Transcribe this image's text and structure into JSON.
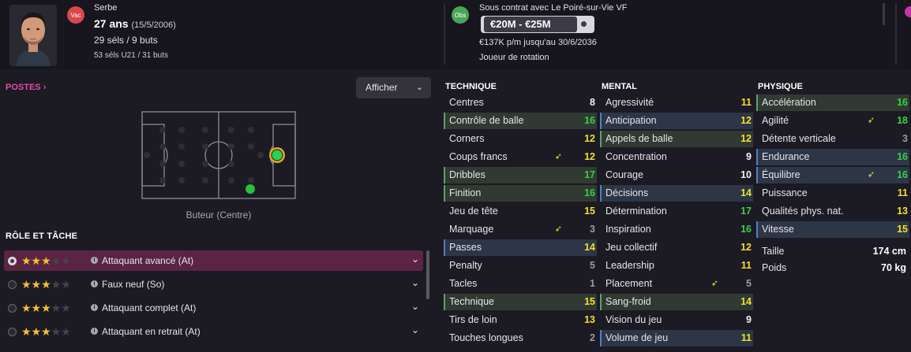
{
  "header": {
    "contract_badge": "Vac",
    "nationality": "Serbe",
    "age": "27 ans",
    "dob": "(15/5/2006)",
    "caps": "29 séls / 9 buts",
    "u21_caps": "53 séls U21 / 31 buts",
    "obs_badge": "Obs",
    "contract_text": "Sous contrat avec Le Poiré-sur-Vie VF",
    "value_range": "€20M - €25M",
    "wage": "€137K p/m jusqu'au 30/6/2036",
    "squad_status": "Joueur de rotation"
  },
  "positions": {
    "link_label": "POSTES",
    "link_chevron": "›",
    "view_button": "Afficher",
    "position_caption": "Buteur (Centre)"
  },
  "roles": {
    "heading": "RÔLE ET TÂCHE",
    "items": [
      {
        "label": "Attaquant avancé (At)",
        "stars": 3,
        "selected": true
      },
      {
        "label": "Faux neuf (So)",
        "stars": 3,
        "selected": false
      },
      {
        "label": "Attaquant complet (At)",
        "stars": 3,
        "selected": false
      },
      {
        "label": "Attaquant en retrait (At)",
        "stars": 3,
        "selected": false
      }
    ]
  },
  "colors": {
    "accent_pink": "#e44aaa",
    "key_green": "#5fa070",
    "key_blue": "#4f7ec4",
    "value_green": "#35d245",
    "value_yellow": "#f2e12a"
  },
  "technical": {
    "title": "TECHNIQUE",
    "rows": [
      {
        "name": "Centres",
        "value": "8",
        "hl": "",
        "arrow": false
      },
      {
        "name": "Contrôle de balle",
        "value": "16",
        "hl": "green",
        "arrow": false
      },
      {
        "name": "Corners",
        "value": "12",
        "hl": "",
        "arrow": false
      },
      {
        "name": "Coups francs",
        "value": "12",
        "hl": "",
        "arrow": true
      },
      {
        "name": "Dribbles",
        "value": "17",
        "hl": "green",
        "arrow": false
      },
      {
        "name": "Finition",
        "value": "16",
        "hl": "green",
        "arrow": false
      },
      {
        "name": "Jeu de tête",
        "value": "15",
        "hl": "",
        "arrow": false
      },
      {
        "name": "Marquage",
        "value": "3",
        "hl": "",
        "arrow": true
      },
      {
        "name": "Passes",
        "value": "14",
        "hl": "blue",
        "arrow": false
      },
      {
        "name": "Penalty",
        "value": "5",
        "hl": "",
        "arrow": false
      },
      {
        "name": "Tacles",
        "value": "1",
        "hl": "",
        "arrow": false
      },
      {
        "name": "Technique",
        "value": "15",
        "hl": "green",
        "arrow": false
      },
      {
        "name": "Tirs de loin",
        "value": "13",
        "hl": "",
        "arrow": false
      },
      {
        "name": "Touches longues",
        "value": "2",
        "hl": "",
        "arrow": false
      }
    ]
  },
  "mental": {
    "title": "MENTAL",
    "rows": [
      {
        "name": "Agressivité",
        "value": "11",
        "hl": "",
        "arrow": false
      },
      {
        "name": "Anticipation",
        "value": "12",
        "hl": "blue",
        "arrow": false
      },
      {
        "name": "Appels de balle",
        "value": "12",
        "hl": "green",
        "arrow": false
      },
      {
        "name": "Concentration",
        "value": "9",
        "hl": "",
        "arrow": false
      },
      {
        "name": "Courage",
        "value": "10",
        "hl": "",
        "arrow": false
      },
      {
        "name": "Décisions",
        "value": "14",
        "hl": "blue",
        "arrow": false
      },
      {
        "name": "Détermination",
        "value": "17",
        "hl": "",
        "arrow": false
      },
      {
        "name": "Inspiration",
        "value": "16",
        "hl": "",
        "arrow": false
      },
      {
        "name": "Jeu collectif",
        "value": "12",
        "hl": "",
        "arrow": false
      },
      {
        "name": "Leadership",
        "value": "11",
        "hl": "",
        "arrow": false
      },
      {
        "name": "Placement",
        "value": "5",
        "hl": "",
        "arrow": true
      },
      {
        "name": "Sang-froid",
        "value": "14",
        "hl": "green",
        "arrow": false
      },
      {
        "name": "Vision du jeu",
        "value": "9",
        "hl": "",
        "arrow": false
      },
      {
        "name": "Volume de jeu",
        "value": "11",
        "hl": "blue",
        "arrow": false
      }
    ]
  },
  "physical": {
    "title": "PHYSIQUE",
    "rows": [
      {
        "name": "Accélération",
        "value": "16",
        "hl": "green",
        "arrow": false
      },
      {
        "name": "Agilité",
        "value": "18",
        "hl": "",
        "arrow": true
      },
      {
        "name": "Détente verticale",
        "value": "3",
        "hl": "",
        "arrow": false
      },
      {
        "name": "Endurance",
        "value": "16",
        "hl": "blue",
        "arrow": false
      },
      {
        "name": "Équilibre",
        "value": "16",
        "hl": "blue",
        "arrow": true
      },
      {
        "name": "Puissance",
        "value": "11",
        "hl": "",
        "arrow": false
      },
      {
        "name": "Qualités phys. nat.",
        "value": "13",
        "hl": "",
        "arrow": false
      },
      {
        "name": "Vitesse",
        "value": "15",
        "hl": "blue",
        "arrow": false
      }
    ],
    "height_label": "Taille",
    "height_value": "174 cm",
    "weight_label": "Poids",
    "weight_value": "70 kg"
  }
}
